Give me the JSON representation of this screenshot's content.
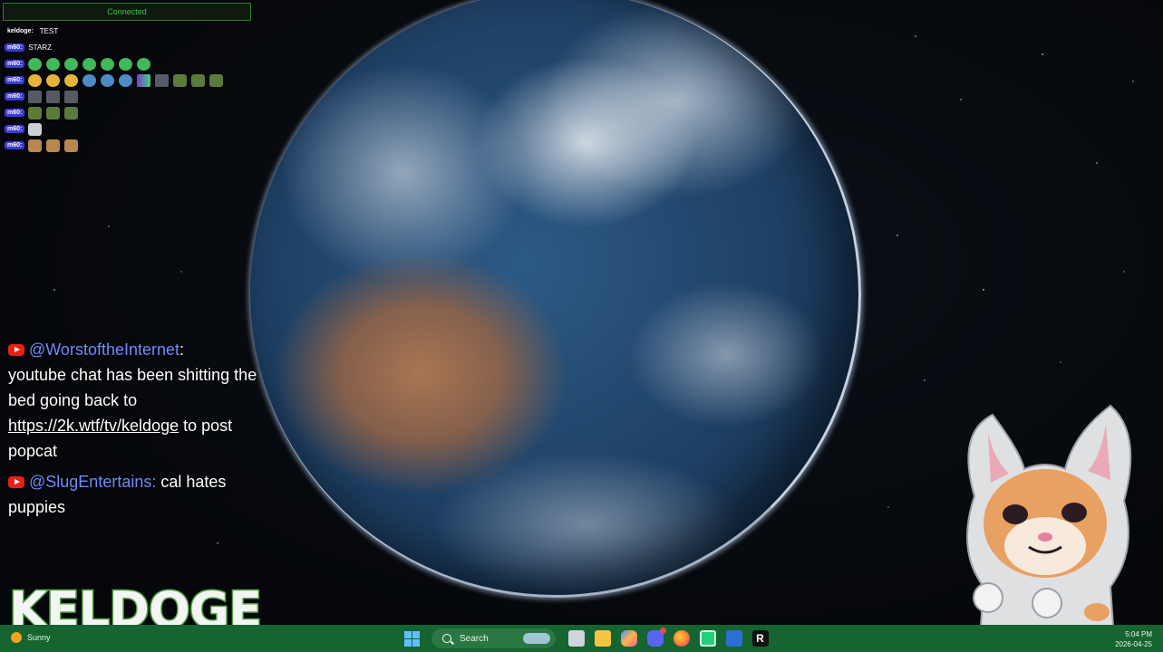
{
  "status": {
    "text": "Connected"
  },
  "small_chat": [
    {
      "user": "keldoge:",
      "style": "plain",
      "message": "test",
      "emotes": []
    },
    {
      "user": "m60:",
      "style": "blue",
      "message": "STARZ",
      "emotes": []
    },
    {
      "user": "m60:",
      "style": "blue",
      "message": "",
      "emotes": [
        "green",
        "green",
        "green",
        "green",
        "green",
        "green",
        "green"
      ]
    },
    {
      "user": "m60:",
      "style": "blue",
      "message": "",
      "emotes": [
        "yellow",
        "yellow",
        "yellow",
        "blue",
        "blue",
        "blue",
        "multi",
        "gray",
        "olive",
        "olive",
        "olive"
      ]
    },
    {
      "user": "m60:",
      "style": "blue",
      "message": "",
      "emotes": [
        "gray",
        "gray",
        "gray"
      ]
    },
    {
      "user": "m60:",
      "style": "blue",
      "message": "",
      "emotes": [
        "olive",
        "olive",
        "olive"
      ]
    },
    {
      "user": "m60:",
      "style": "blue",
      "message": "",
      "emotes": [
        "white"
      ]
    },
    {
      "user": "m60:",
      "style": "blue",
      "message": "",
      "emotes": [
        "tan",
        "tan",
        "tan"
      ]
    }
  ],
  "big_chat": {
    "msg1": {
      "user": "@WorstoftheInternet",
      "sep": ":",
      "text_a": "youtube chat has been shitting the bed going back to ",
      "link": "https://2k.wtf/tv/keldoge",
      "text_b": " to post popcat"
    },
    "msg2": {
      "user": "@SlugEntertains",
      "sep": ":",
      "text": " cal hates puppies"
    }
  },
  "logo": {
    "text": "KELDOGE"
  },
  "taskbar": {
    "weather": "Sunny",
    "search_label": "Search",
    "r_label": "R",
    "time": "5:04 PM",
    "date": "2026-04-25",
    "icons": [
      "windows-start-icon",
      "search-icon",
      "task-view-icon",
      "file-explorer-icon",
      "copilot-icon",
      "discord-icon",
      "firefox-icon",
      "chat-app-icon",
      "word-app-icon",
      "r-app-icon"
    ]
  },
  "colors": {
    "taskbar": "#16642f",
    "accent_green": "#4aa83e",
    "username_blue": "#6f8cff",
    "youtube_red": "#e62117"
  }
}
